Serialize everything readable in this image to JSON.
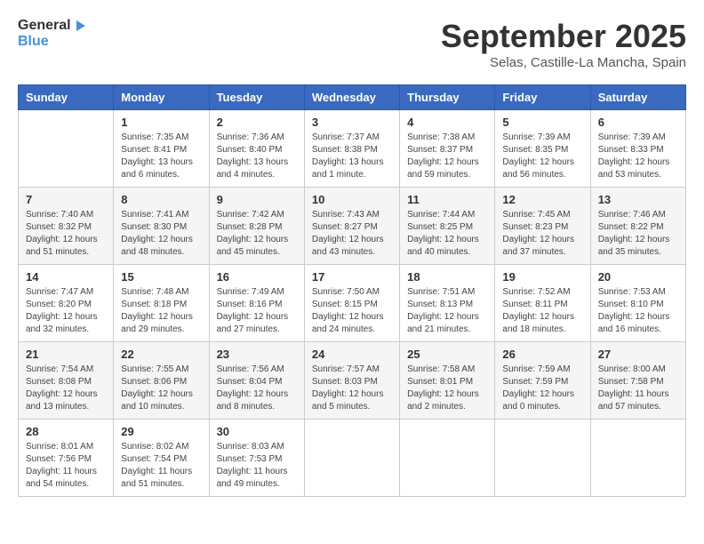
{
  "header": {
    "logo_general": "General",
    "logo_blue": "Blue",
    "month_title": "September 2025",
    "location": "Selas, Castille-La Mancha, Spain"
  },
  "weekdays": [
    "Sunday",
    "Monday",
    "Tuesday",
    "Wednesday",
    "Thursday",
    "Friday",
    "Saturday"
  ],
  "weeks": [
    [
      {
        "day": "",
        "info": ""
      },
      {
        "day": "1",
        "info": "Sunrise: 7:35 AM\nSunset: 8:41 PM\nDaylight: 13 hours\nand 6 minutes."
      },
      {
        "day": "2",
        "info": "Sunrise: 7:36 AM\nSunset: 8:40 PM\nDaylight: 13 hours\nand 4 minutes."
      },
      {
        "day": "3",
        "info": "Sunrise: 7:37 AM\nSunset: 8:38 PM\nDaylight: 13 hours\nand 1 minute."
      },
      {
        "day": "4",
        "info": "Sunrise: 7:38 AM\nSunset: 8:37 PM\nDaylight: 12 hours\nand 59 minutes."
      },
      {
        "day": "5",
        "info": "Sunrise: 7:39 AM\nSunset: 8:35 PM\nDaylight: 12 hours\nand 56 minutes."
      },
      {
        "day": "6",
        "info": "Sunrise: 7:39 AM\nSunset: 8:33 PM\nDaylight: 12 hours\nand 53 minutes."
      }
    ],
    [
      {
        "day": "7",
        "info": "Sunrise: 7:40 AM\nSunset: 8:32 PM\nDaylight: 12 hours\nand 51 minutes."
      },
      {
        "day": "8",
        "info": "Sunrise: 7:41 AM\nSunset: 8:30 PM\nDaylight: 12 hours\nand 48 minutes."
      },
      {
        "day": "9",
        "info": "Sunrise: 7:42 AM\nSunset: 8:28 PM\nDaylight: 12 hours\nand 45 minutes."
      },
      {
        "day": "10",
        "info": "Sunrise: 7:43 AM\nSunset: 8:27 PM\nDaylight: 12 hours\nand 43 minutes."
      },
      {
        "day": "11",
        "info": "Sunrise: 7:44 AM\nSunset: 8:25 PM\nDaylight: 12 hours\nand 40 minutes."
      },
      {
        "day": "12",
        "info": "Sunrise: 7:45 AM\nSunset: 8:23 PM\nDaylight: 12 hours\nand 37 minutes."
      },
      {
        "day": "13",
        "info": "Sunrise: 7:46 AM\nSunset: 8:22 PM\nDaylight: 12 hours\nand 35 minutes."
      }
    ],
    [
      {
        "day": "14",
        "info": "Sunrise: 7:47 AM\nSunset: 8:20 PM\nDaylight: 12 hours\nand 32 minutes."
      },
      {
        "day": "15",
        "info": "Sunrise: 7:48 AM\nSunset: 8:18 PM\nDaylight: 12 hours\nand 29 minutes."
      },
      {
        "day": "16",
        "info": "Sunrise: 7:49 AM\nSunset: 8:16 PM\nDaylight: 12 hours\nand 27 minutes."
      },
      {
        "day": "17",
        "info": "Sunrise: 7:50 AM\nSunset: 8:15 PM\nDaylight: 12 hours\nand 24 minutes."
      },
      {
        "day": "18",
        "info": "Sunrise: 7:51 AM\nSunset: 8:13 PM\nDaylight: 12 hours\nand 21 minutes."
      },
      {
        "day": "19",
        "info": "Sunrise: 7:52 AM\nSunset: 8:11 PM\nDaylight: 12 hours\nand 18 minutes."
      },
      {
        "day": "20",
        "info": "Sunrise: 7:53 AM\nSunset: 8:10 PM\nDaylight: 12 hours\nand 16 minutes."
      }
    ],
    [
      {
        "day": "21",
        "info": "Sunrise: 7:54 AM\nSunset: 8:08 PM\nDaylight: 12 hours\nand 13 minutes."
      },
      {
        "day": "22",
        "info": "Sunrise: 7:55 AM\nSunset: 8:06 PM\nDaylight: 12 hours\nand 10 minutes."
      },
      {
        "day": "23",
        "info": "Sunrise: 7:56 AM\nSunset: 8:04 PM\nDaylight: 12 hours\nand 8 minutes."
      },
      {
        "day": "24",
        "info": "Sunrise: 7:57 AM\nSunset: 8:03 PM\nDaylight: 12 hours\nand 5 minutes."
      },
      {
        "day": "25",
        "info": "Sunrise: 7:58 AM\nSunset: 8:01 PM\nDaylight: 12 hours\nand 2 minutes."
      },
      {
        "day": "26",
        "info": "Sunrise: 7:59 AM\nSunset: 7:59 PM\nDaylight: 12 hours\nand 0 minutes."
      },
      {
        "day": "27",
        "info": "Sunrise: 8:00 AM\nSunset: 7:58 PM\nDaylight: 11 hours\nand 57 minutes."
      }
    ],
    [
      {
        "day": "28",
        "info": "Sunrise: 8:01 AM\nSunset: 7:56 PM\nDaylight: 11 hours\nand 54 minutes."
      },
      {
        "day": "29",
        "info": "Sunrise: 8:02 AM\nSunset: 7:54 PM\nDaylight: 11 hours\nand 51 minutes."
      },
      {
        "day": "30",
        "info": "Sunrise: 8:03 AM\nSunset: 7:53 PM\nDaylight: 11 hours\nand 49 minutes."
      },
      {
        "day": "",
        "info": ""
      },
      {
        "day": "",
        "info": ""
      },
      {
        "day": "",
        "info": ""
      },
      {
        "day": "",
        "info": ""
      }
    ]
  ]
}
